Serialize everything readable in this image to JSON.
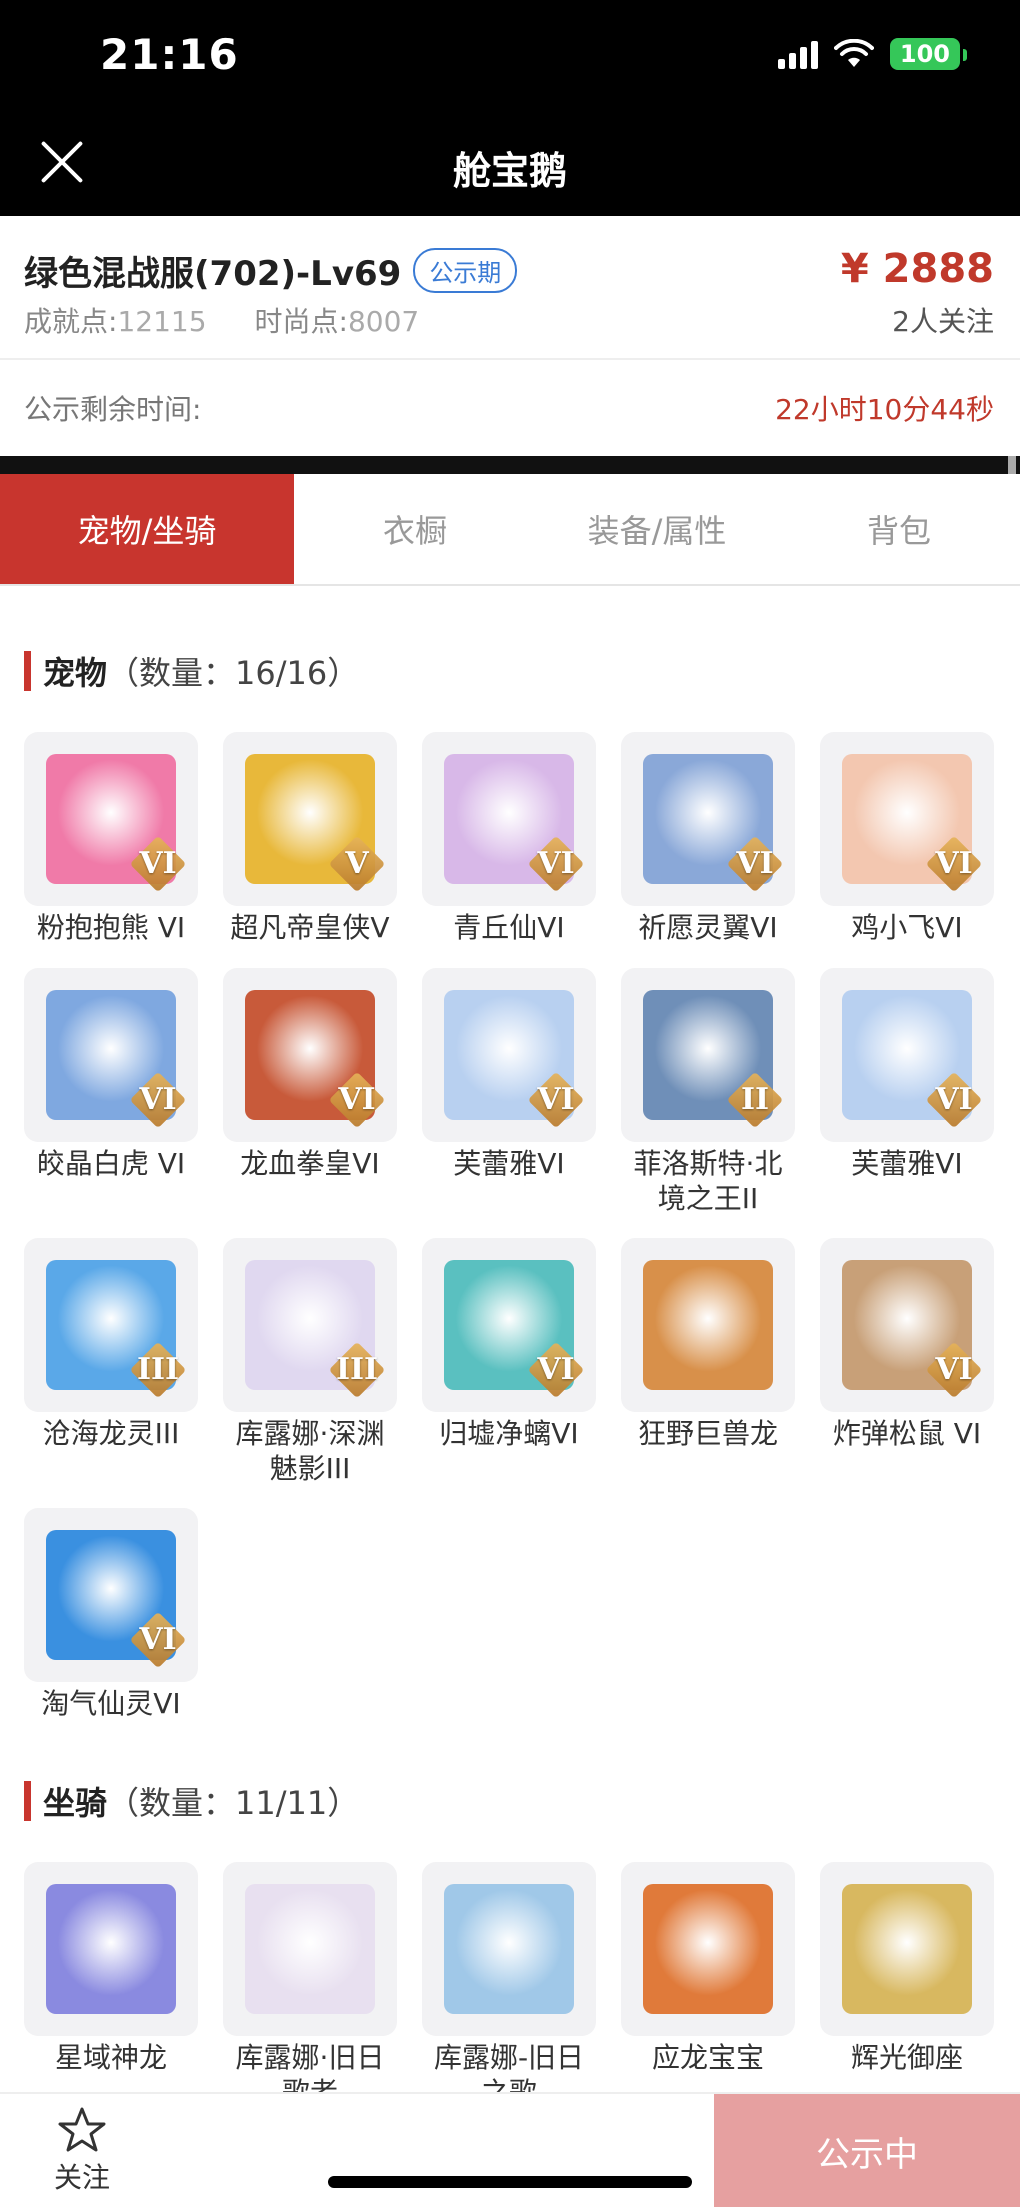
{
  "status": {
    "time": "21:16",
    "battery": "100"
  },
  "nav": {
    "title": "舱宝鹅"
  },
  "listing": {
    "server": "绿色混战服(702)-Lv69",
    "badge": "公示期",
    "price": "¥ 2888",
    "followers": "2人关注",
    "achievement_label": "成就点:",
    "achievement_value": "12115",
    "fashion_label": "时尚点:",
    "fashion_value": "8007",
    "countdown_label": "公示剩余时间:",
    "countdown_value": "22小时10分44秒"
  },
  "tabs": [
    "宠物/坐骑",
    "衣橱",
    "装备/属性",
    "背包"
  ],
  "pets": {
    "title": "宠物",
    "count": "（数量：16/16）",
    "items": [
      {
        "name": "粉抱抱熊 VI",
        "grade": "VI",
        "color": "#f07aa8"
      },
      {
        "name": "超凡帝皇侠V",
        "grade": "V",
        "color": "#e8b83a"
      },
      {
        "name": "青丘仙VI",
        "grade": "VI",
        "color": "#d8b8e8"
      },
      {
        "name": "祈愿灵翼VI",
        "grade": "VI",
        "color": "#8aa8d8"
      },
      {
        "name": "鸡小飞VI",
        "grade": "VI",
        "color": "#f3c7b0"
      },
      {
        "name": "皎晶白虎 VI",
        "grade": "VI",
        "color": "#7fa8e0"
      },
      {
        "name": "龙血拳皇VI",
        "grade": "VI",
        "color": "#c85a3a"
      },
      {
        "name": "芙蕾雅VI",
        "grade": "VI",
        "color": "#b8d0f0"
      },
      {
        "name": "菲洛斯特·北境之王II",
        "grade": "II",
        "color": "#6f8fb8"
      },
      {
        "name": "芙蕾雅VI",
        "grade": "VI",
        "color": "#b8d0f0"
      },
      {
        "name": "沧海龙灵III",
        "grade": "III",
        "color": "#5aa8e8"
      },
      {
        "name": "库露娜·深渊魅影III",
        "grade": "III",
        "color": "#e0d8f0"
      },
      {
        "name": "归墟净螭VI",
        "grade": "VI",
        "color": "#5ac0c0"
      },
      {
        "name": "狂野巨兽龙",
        "grade": "",
        "color": "#d8904a"
      },
      {
        "name": "炸弹松鼠 VI",
        "grade": "VI",
        "color": "#c8a078"
      },
      {
        "name": "淘气仙灵VI",
        "grade": "VI",
        "color": "#3a90e0"
      }
    ]
  },
  "mounts": {
    "title": "坐骑",
    "count": "（数量：11/11）",
    "items": [
      {
        "name": "星域神龙",
        "color": "#8a8ae0"
      },
      {
        "name": "库露娜·旧日歌者",
        "color": "#e8e0f0"
      },
      {
        "name": "库露娜-旧日之歌",
        "color": "#a0c8e8"
      },
      {
        "name": "应龙宝宝",
        "color": "#e07a3a"
      },
      {
        "name": "辉光御座",
        "color": "#d8b860"
      }
    ]
  },
  "bottom": {
    "follow": "关注",
    "cta": "公示中"
  }
}
